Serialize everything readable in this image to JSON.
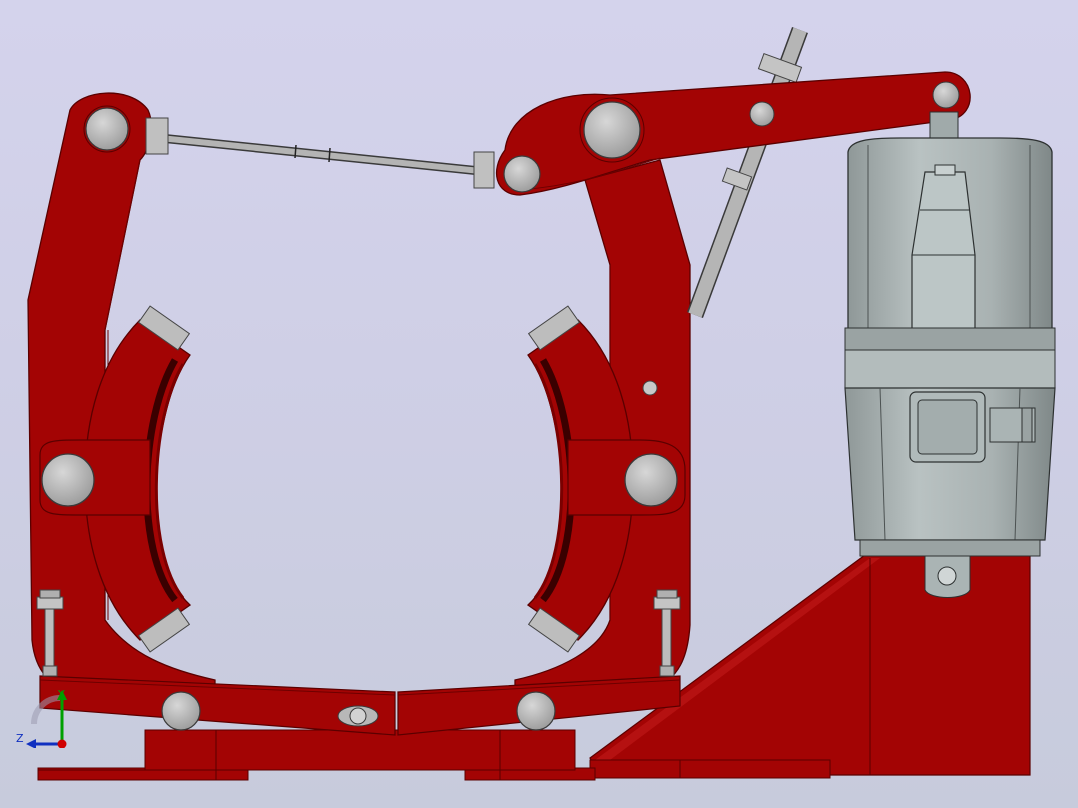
{
  "viewport": {
    "background_top": "#d4d3ec",
    "background_bottom": "#c7cbdc"
  },
  "colors": {
    "frame_red": "#a30404",
    "frame_red_edge": "#5a0000",
    "steel_gray": "#a8a8a8",
    "steel_edge": "#3a3a3a",
    "actuator_gray": "#a9b2b2",
    "actuator_edge": "#2d3131",
    "axis_x": "#d00000",
    "axis_y": "#00a000",
    "axis_z": "#1030c0"
  },
  "triad": {
    "icon": "coordinate-triad-icon",
    "y_label": "Y",
    "z_label": "Z"
  }
}
